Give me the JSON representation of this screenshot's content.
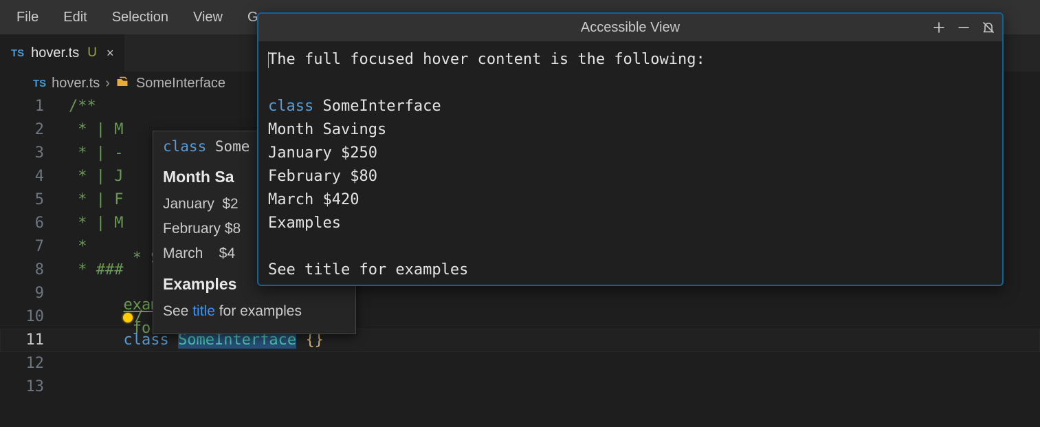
{
  "menubar": {
    "items": [
      "File",
      "Edit",
      "Selection",
      "View",
      "Go"
    ]
  },
  "tab": {
    "lang_badge": "TS",
    "filename": "hover.ts",
    "modified_badge": "U",
    "close_glyph": "×"
  },
  "breadcrumb": {
    "lang_badge": "TS",
    "filename": "hover.ts",
    "sep": "›",
    "symbol": "SomeInterface"
  },
  "editor": {
    "lines": [
      {
        "n": "1",
        "text": "/**"
      },
      {
        "n": "2",
        "text": " * | M"
      },
      {
        "n": "3",
        "text": " * | -"
      },
      {
        "n": "4",
        "text": " * | J"
      },
      {
        "n": "5",
        "text": " * | F"
      },
      {
        "n": "6",
        "text": " * | M"
      },
      {
        "n": "7",
        "text": " *"
      },
      {
        "n": "8",
        "text": " * ###"
      },
      {
        "n": "9",
        "text": " * See"
      },
      {
        "n": "10",
        "text": "/"
      }
    ],
    "line9_url_fragment": "example.com/)",
    "line9_tail": " for examples",
    "line11": {
      "n": "11",
      "kw": "class",
      "name": "SomeInterface",
      "braces": "{}"
    },
    "blank_lines": [
      "12",
      "13"
    ]
  },
  "hover_popup": {
    "sig_kw": "class",
    "sig_name": "Some",
    "heading1": "Month  Sa",
    "rows": [
      "January  $2",
      "February $8",
      "March    $4"
    ],
    "heading2": "Examples",
    "see_prefix": "See ",
    "see_link": "title",
    "see_suffix": " for examples"
  },
  "accessible_view": {
    "title": "Accessible View",
    "lines": [
      "The full focused hover content is the following:",
      "",
      "__KW__class__/KW__ SomeInterface",
      "Month Savings",
      "January $250",
      "February $80",
      "March $420",
      "Examples",
      "",
      "See title for examples"
    ]
  }
}
